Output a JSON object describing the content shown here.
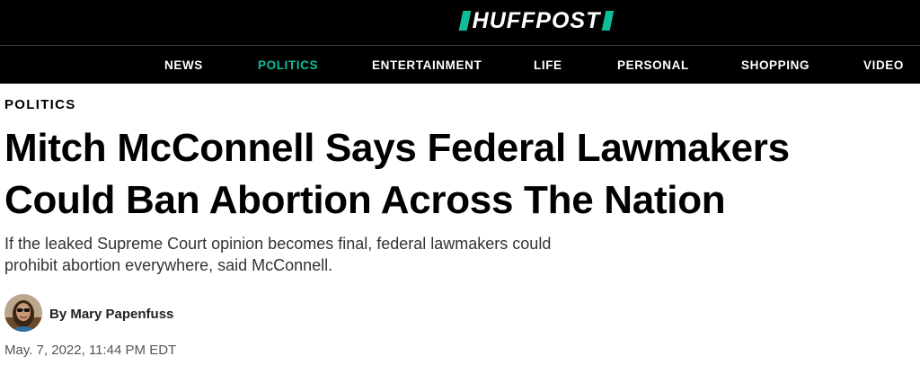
{
  "header": {
    "logo_text": "HUFFPOST",
    "brand_color": "#0dbe98",
    "nav": [
      {
        "label": "NEWS",
        "active": false
      },
      {
        "label": "POLITICS",
        "active": true
      },
      {
        "label": "ENTERTAINMENT",
        "active": false
      },
      {
        "label": "LIFE",
        "active": false
      },
      {
        "label": "PERSONAL",
        "active": false
      },
      {
        "label": "SHOPPING",
        "active": false
      },
      {
        "label": "VIDEO",
        "active": false
      }
    ]
  },
  "article": {
    "section": "POLITICS",
    "headline_line1": "Mitch McConnell Says Federal Lawmakers",
    "headline_line2": "Could Ban Abortion Across The Nation",
    "dek_line1": "If the leaked Supreme Court opinion becomes final, federal lawmakers could",
    "dek_line2": "prohibit abortion everywhere, said McConnell.",
    "byline": "By Mary Papenfuss",
    "author_avatar_icon": "author-photo",
    "timestamp": "May. 7, 2022, 11:44 PM EDT"
  }
}
